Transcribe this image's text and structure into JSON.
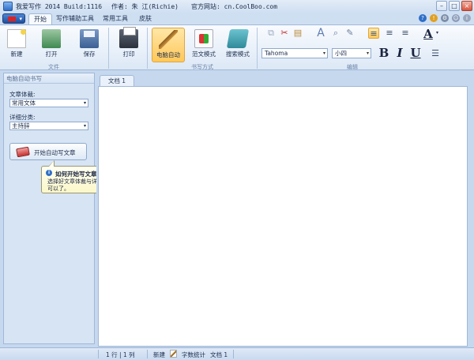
{
  "window": {
    "title": "我爱写作 2014 Build:1116",
    "author": "作者: 朱 江(Richie)",
    "website": "官方网站: cn.CoolBoo.com"
  },
  "ribbon_tabs": [
    "开始",
    "写作辅助工具",
    "常用工具",
    "皮肤"
  ],
  "ribbon": {
    "file_group": {
      "label": "文件",
      "new": "新建",
      "open": "打开",
      "save": "保存",
      "print": "打印"
    },
    "writing_group": {
      "label": "书写方式",
      "auto": "电脑自动",
      "template": "范文模式",
      "search": "搜索模式"
    },
    "edit_group": {
      "label": "编辑",
      "font": "Tahoma",
      "size": "小四",
      "bold": "B",
      "italic": "I",
      "underline": "U",
      "font_color": "A"
    }
  },
  "left_pane": {
    "title": "电脑自动书写",
    "genre_label": "文章体裁:",
    "genre_value": "常用文体",
    "category_label": "详细分类:",
    "category_value": "主持辞",
    "generate_button": "开始自动写文章"
  },
  "tooltip": {
    "title": "如何开始写文章",
    "body": "选择好文章体裁与详细分类后点击此处，按提示步骤操作就可以了。",
    "close": "×"
  },
  "document": {
    "tab": "文档 1"
  },
  "status": {
    "position": "1 行 | 1 列",
    "new": "新建",
    "word_count": "字数统计",
    "doc": "文档 1"
  },
  "colors": {
    "accent": "#ffc85a",
    "frame": "#c6d8ee"
  }
}
